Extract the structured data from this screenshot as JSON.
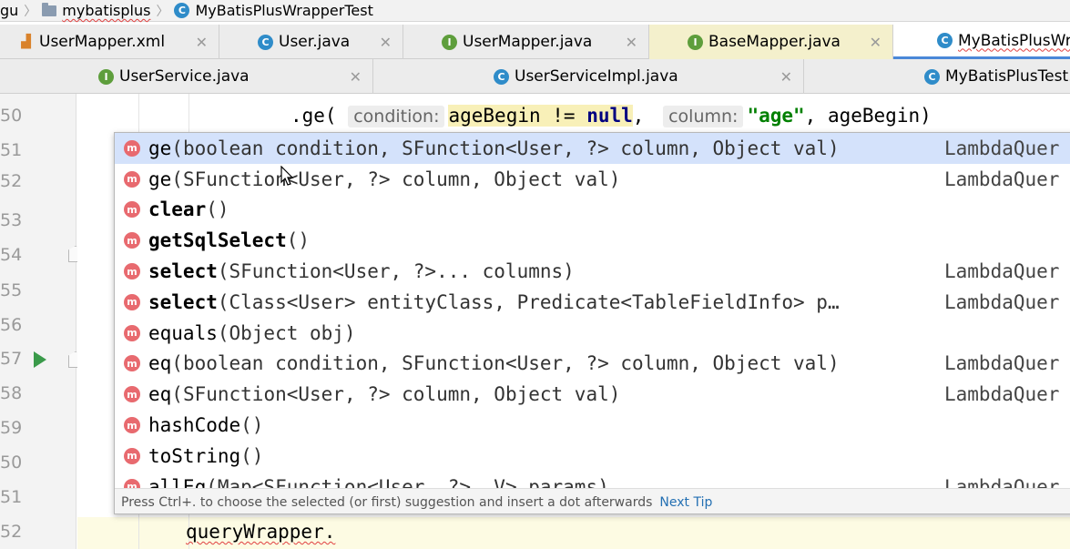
{
  "breadcrumb": {
    "items": [
      {
        "label": "gu",
        "icon": ""
      },
      {
        "label": "mybatisplus",
        "icon": "folder-icon"
      },
      {
        "label": "MyBatisPlusWrapperTest",
        "icon": "class-icon"
      }
    ]
  },
  "tabs_row1": [
    {
      "label": "UserMapper.xml",
      "icon": "xml-icon"
    },
    {
      "label": "User.java",
      "icon": "class-icon"
    },
    {
      "label": "UserMapper.java",
      "icon": "interface-icon"
    },
    {
      "label": "BaseMapper.java",
      "icon": "interface-icon"
    },
    {
      "label": "MyBatisPlusWra",
      "icon": "class-icon"
    }
  ],
  "tabs_row2": [
    {
      "label": "UserService.java",
      "icon": "interface-icon"
    },
    {
      "label": "UserServiceImpl.java",
      "icon": "class-icon"
    },
    {
      "label": "MyBatisPlusTest.j",
      "icon": "class-icon"
    }
  ],
  "icon_letters": {
    "class": "C",
    "interface": "I",
    "method": "m"
  },
  "gutter": {
    "line_numbers": [
      "50",
      "51",
      "52",
      "53",
      "54",
      "55",
      "56",
      "57",
      "58",
      "59",
      "50",
      "51",
      "52"
    ]
  },
  "code": {
    "line1": {
      "method": ".ge(",
      "hint_condition": "condition:",
      "arg1_var": "ageBegin",
      "arg1_op": " != ",
      "arg1_null": "null",
      "comma": ",",
      "hint_column": "column:",
      "arg2": "\"age\"",
      "arg3": ", ageBegin)"
    },
    "current_line": "queryWrapper."
  },
  "completion": {
    "items": [
      {
        "name": "ge",
        "params": "(boolean condition, SFunction<User, ?> column, Object val)",
        "owner": "LambdaQuer",
        "bold": false,
        "selected": true
      },
      {
        "name": "ge",
        "params": "(SFunction<User, ?> column, Object val)",
        "owner": "LambdaQuer",
        "bold": false,
        "selected": false
      },
      {
        "name": "clear",
        "params": "()",
        "owner": "",
        "bold": true,
        "selected": false
      },
      {
        "name": "getSqlSelect",
        "params": "()",
        "owner": "",
        "bold": true,
        "selected": false
      },
      {
        "name": "select",
        "params": "(SFunction<User, ?>... columns)",
        "owner": "LambdaQuer",
        "bold": true,
        "selected": false
      },
      {
        "name": "select",
        "params": "(Class<User> entityClass, Predicate<TableFieldInfo> p…",
        "owner": "LambdaQuer",
        "bold": true,
        "selected": false
      },
      {
        "name": "equals",
        "params": "(Object obj)",
        "owner": "",
        "bold": false,
        "selected": false
      },
      {
        "name": "eq",
        "params": "(boolean condition, SFunction<User, ?> column, Object val)",
        "owner": "LambdaQuer",
        "bold": false,
        "selected": false
      },
      {
        "name": "eq",
        "params": "(SFunction<User, ?> column, Object val)",
        "owner": "LambdaQuer",
        "bold": false,
        "selected": false
      },
      {
        "name": "hashCode",
        "params": "()",
        "owner": "",
        "bold": false,
        "selected": false
      },
      {
        "name": "toString",
        "params": "()",
        "owner": "",
        "bold": false,
        "selected": false
      },
      {
        "name": "allEq",
        "params": "(Map<SFunction<User, ?>, V> params)",
        "owner": "LambdaQuer",
        "bold": false,
        "selected": false
      }
    ],
    "footer_text": "Press Ctrl+. to choose the selected (or first) suggestion and insert a dot afterwards",
    "next_tip": "Next Tip"
  },
  "colors": {
    "selection": "#d4e2fb",
    "method_icon": "#e86a6f",
    "class_icon": "#2f8cc9",
    "interface_icon": "#5e9e3c",
    "keyword": "#000080",
    "string": "#008000",
    "active_tab_underline": "#4a88d8"
  }
}
